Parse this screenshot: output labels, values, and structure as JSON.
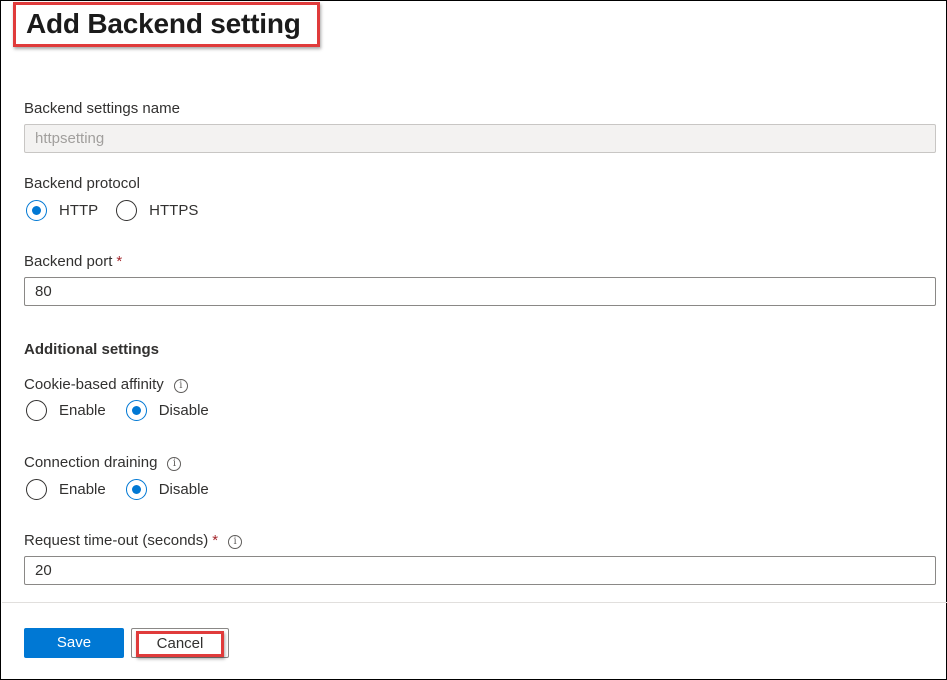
{
  "header": {
    "title": "Add Backend setting"
  },
  "form": {
    "settings_name": {
      "label": "Backend settings name",
      "value": "httpsetting"
    },
    "protocol": {
      "label": "Backend protocol",
      "options": [
        "HTTP",
        "HTTPS"
      ],
      "selected": "HTTP"
    },
    "port": {
      "label": "Backend port",
      "required_mark": "*",
      "value": "80"
    },
    "additional": {
      "heading": "Additional settings"
    },
    "cookie_affinity": {
      "label": "Cookie-based affinity",
      "info": "i",
      "options": [
        "Enable",
        "Disable"
      ],
      "selected": "Disable"
    },
    "connection_draining": {
      "label": "Connection draining",
      "info": "i",
      "options": [
        "Enable",
        "Disable"
      ],
      "selected": "Disable"
    },
    "timeout": {
      "label": "Request time-out (seconds)",
      "required_mark": "*",
      "info": "i",
      "value": "20"
    }
  },
  "footer": {
    "save_label": "Save",
    "cancel_label": "Cancel"
  },
  "colors": {
    "accent": "#0078d4",
    "highlight": "#e03b3b",
    "required": "#a4262c"
  }
}
